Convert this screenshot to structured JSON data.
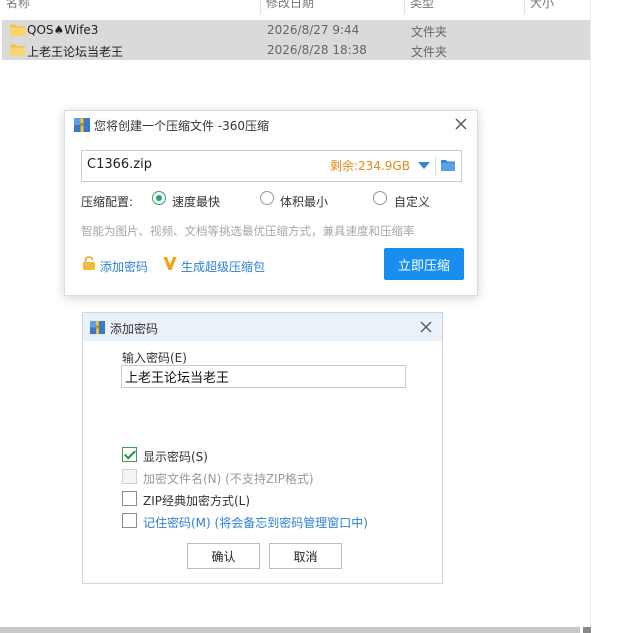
{
  "explorer": {
    "columns": [
      "名称",
      "修改日期",
      "类型",
      "大小"
    ],
    "files": [
      {
        "name": "QOS♠Wife3",
        "date": "2026/8/27 9:44",
        "type": "文件夹"
      },
      {
        "name": "上老王论坛当老王",
        "date": "2026/8/28 18:38",
        "type": "文件夹"
      }
    ]
  },
  "zip_dialog": {
    "title": "您将创建一个压缩文件 -360压缩",
    "filename": "C1366.zip",
    "free_space": "剩余:234.9GB",
    "config_label": "压缩配置:",
    "options": [
      {
        "label": "速度最快",
        "selected": true
      },
      {
        "label": "体积最小",
        "selected": false
      },
      {
        "label": "自定义",
        "selected": false
      }
    ],
    "hint": "智能为图片、视频、文档等挑选最优压缩方式，兼具速度和压缩率",
    "add_password": "添加密码",
    "super_pack": "生成超级压缩包",
    "compress_now": "立即压缩"
  },
  "pw_dialog": {
    "title": "添加密码",
    "input_label": "输入密码(E)",
    "password": "上老王论坛当老王",
    "checkboxes": [
      {
        "label": "显示密码(S)",
        "checked": true,
        "disabled": false
      },
      {
        "label": "加密文件名(N) (不支持ZIP格式)",
        "checked": false,
        "disabled": true
      },
      {
        "label": "ZIP经典加密方式(L)",
        "checked": false,
        "disabled": false
      },
      {
        "label": "记住密码(M) (将会备忘到密码管理窗口中)",
        "checked": false,
        "disabled": false
      }
    ],
    "ok": "确认",
    "cancel": "取消"
  },
  "colors": {
    "accent": "#1a8ef0",
    "link": "#2d7fd3",
    "space": "#e08a18",
    "selected_row": "#dadada"
  }
}
